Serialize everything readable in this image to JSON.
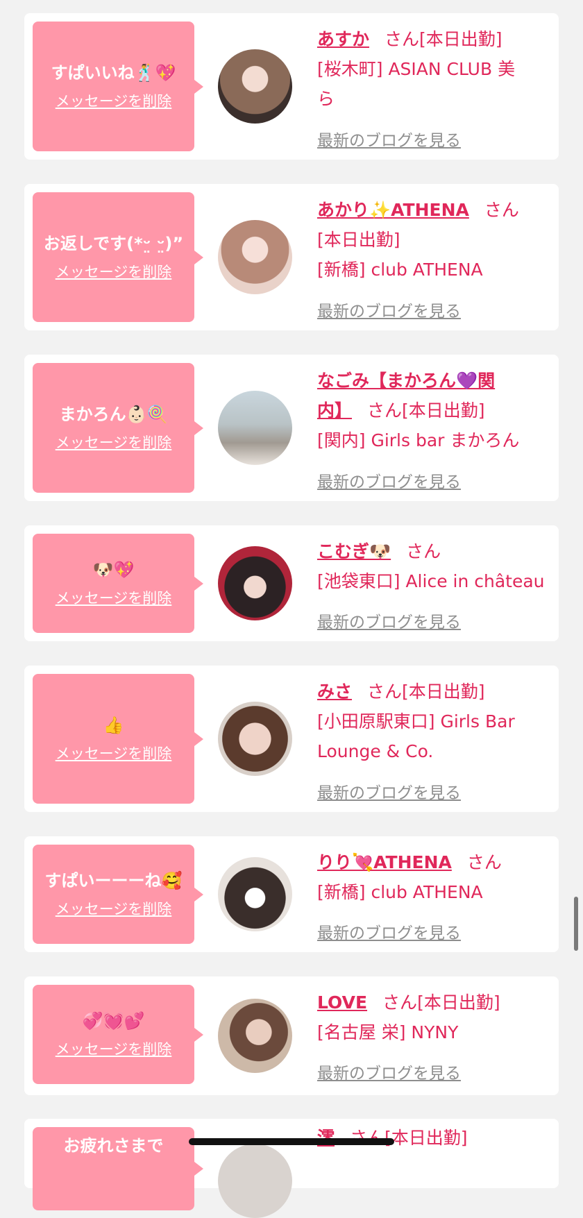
{
  "delete_label": "メッセージを削除",
  "blog_label": "最新のブログを見る",
  "san_label": "さん",
  "cards": [
    {
      "reply": "すぱいいね🕺💖",
      "name": "あすか",
      "shift": "[本日出勤]",
      "store_line1": "[桜木町] ASIAN CLUB 美",
      "store_line2": "ら"
    },
    {
      "reply": "お返しです(*ᵕ̤ ᵕ̤)”",
      "name": "あかり✨ATHENA",
      "shift": "[本日出勤]",
      "store_line1": "[新橋] club ATHENA",
      "store_line2": ""
    },
    {
      "reply": "まかろん👶🏻🍭",
      "name_line1": "なごみ【まかろん💜関",
      "name_line2": "内】",
      "shift": "[本日出勤]",
      "store_line1": "[関内] Girls bar まかろん",
      "store_line2": ""
    },
    {
      "reply": "🐶💖",
      "name": "こむぎ🐶",
      "shift": "",
      "store_line1": "[池袋東口] Alice in château",
      "store_line2": ""
    },
    {
      "reply": "👍",
      "name": "みさ",
      "shift": "[本日出勤]",
      "store_line1": "[小田原駅東口] Girls Bar",
      "store_line2": "Lounge & Co."
    },
    {
      "reply": "すぱいーーーね🥰",
      "name": "りり💘ATHENA",
      "shift": "",
      "store_line1": "[新橋] club ATHENA",
      "store_line2": ""
    },
    {
      "reply": "💞💓💕",
      "name": "LOVE",
      "shift": "[本日出勤]",
      "store_line1": "[名古屋 栄] NYNY",
      "store_line2": ""
    },
    {
      "reply": "お疲れさまで",
      "name": "澪",
      "shift": "[本日出勤]",
      "store_line1": "",
      "store_line2": ""
    }
  ],
  "colors": {
    "bubble": "#ff97a9",
    "name": "#e0275a",
    "link_gray": "#8e8e8e",
    "background": "#f2f2f2"
  }
}
